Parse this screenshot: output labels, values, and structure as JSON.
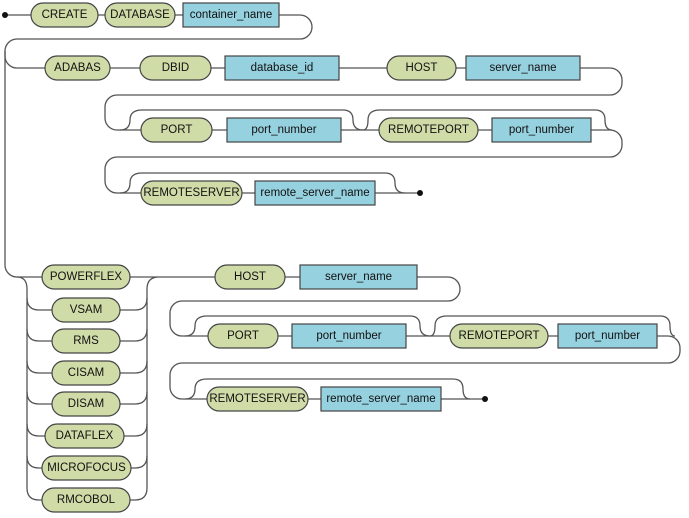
{
  "colors": {
    "terminal_fill": "#cfdca8",
    "nonterminal_fill": "#96d1df",
    "line": "#555555"
  },
  "row1": {
    "create": "CREATE",
    "database": "DATABASE",
    "container_name": "container_name"
  },
  "adabas": {
    "adabas": "ADABAS",
    "dbid": "DBID",
    "database_id": "database_id",
    "host": "HOST",
    "server_name": "server_name",
    "port": "PORT",
    "port_number": "port_number",
    "remoteport": "REMOTEPORT",
    "remoteport_number": "port_number",
    "remoteserver": "REMOTESERVER",
    "remote_server_name": "remote_server_name"
  },
  "file_types": [
    "POWERFLEX",
    "VSAM",
    "RMS",
    "CISAM",
    "DISAM",
    "DATAFLEX",
    "MICROFOCUS",
    "RMCOBOL"
  ],
  "other": {
    "host": "HOST",
    "server_name": "server_name",
    "port": "PORT",
    "port_number": "port_number",
    "remoteport": "REMOTEPORT",
    "remoteport_number": "port_number",
    "remoteserver": "REMOTESERVER",
    "remote_server_name": "remote_server_name"
  }
}
